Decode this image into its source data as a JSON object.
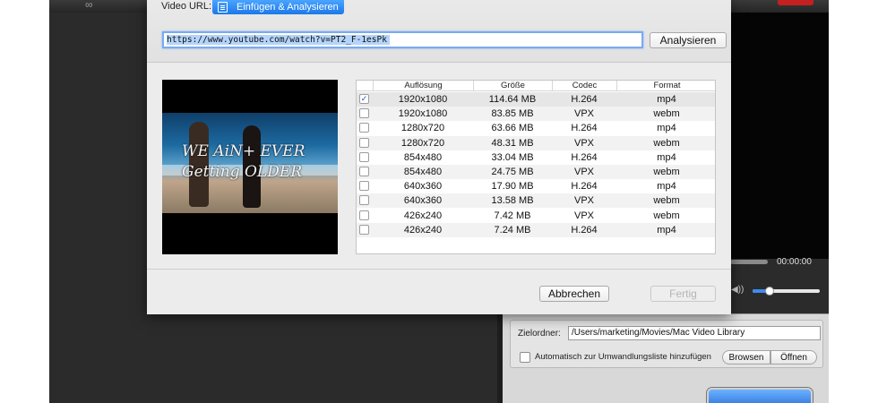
{
  "dialog": {
    "url_label": "Video URL:",
    "paste_button_label": "Einfügen & Analysieren",
    "url_value": "https://www.youtube.com/watch?v=PT2_F-1esPk",
    "analyze_button_label": "Analysieren",
    "cancel_button_label": "Abbrechen",
    "done_button_label": "Fertig",
    "thumbnail_text": "WE AiN+ EVER\nGetting OLDER"
  },
  "table": {
    "headers": [
      "Auflösung",
      "Größe",
      "Codec",
      "Format"
    ],
    "rows": [
      {
        "checked": true,
        "resolution": "1920x1080",
        "size": "114.64 MB",
        "codec": "H.264",
        "format": "mp4"
      },
      {
        "checked": false,
        "resolution": "1920x1080",
        "size": "83.85 MB",
        "codec": "VPX",
        "format": "webm"
      },
      {
        "checked": false,
        "resolution": "1280x720",
        "size": "63.66 MB",
        "codec": "H.264",
        "format": "mp4"
      },
      {
        "checked": false,
        "resolution": "1280x720",
        "size": "48.31 MB",
        "codec": "VPX",
        "format": "webm"
      },
      {
        "checked": false,
        "resolution": "854x480",
        "size": "33.04 MB",
        "codec": "H.264",
        "format": "mp4"
      },
      {
        "checked": false,
        "resolution": "854x480",
        "size": "24.75 MB",
        "codec": "VPX",
        "format": "webm"
      },
      {
        "checked": false,
        "resolution": "640x360",
        "size": "17.90 MB",
        "codec": "H.264",
        "format": "mp4"
      },
      {
        "checked": false,
        "resolution": "640x360",
        "size": "13.58 MB",
        "codec": "VPX",
        "format": "webm"
      },
      {
        "checked": false,
        "resolution": "426x240",
        "size": "7.42 MB",
        "codec": "VPX",
        "format": "webm"
      },
      {
        "checked": false,
        "resolution": "426x240",
        "size": "7.24 MB",
        "codec": "H.264",
        "format": "mp4"
      }
    ]
  },
  "player": {
    "time": "00:00:00",
    "volume_level": 0.25
  },
  "output": {
    "dest_label": "Zielordner:",
    "dest_path": "/Users/marketing/Movies/Mac Video Library",
    "auto_add_label": "Automatisch zur Umwandlungsliste hinzufügen",
    "auto_add_checked": false,
    "browse_label": "Browsen",
    "open_label": "Öffnen"
  },
  "icons": {
    "paste": "paste-icon",
    "speaker": "speaker-icon",
    "app_logo": "app-logo-icon"
  },
  "colors": {
    "accent": "#1a78e8",
    "selection": "#b4d4fb",
    "app_background": "#2b2b2b",
    "dialog_background": "#ececec"
  }
}
